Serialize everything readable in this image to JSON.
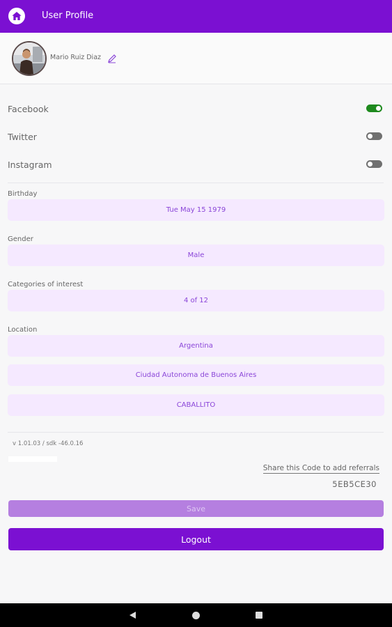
{
  "header": {
    "title": "User Profile",
    "home_icon": "home-icon",
    "bar_color": "#7b10d2"
  },
  "profile": {
    "name": "Mario Ruiz Diaz",
    "edit_icon": "pencil-icon"
  },
  "social": [
    {
      "label": "Facebook",
      "enabled": true
    },
    {
      "label": "Twitter",
      "enabled": false
    },
    {
      "label": "Instagram",
      "enabled": false
    }
  ],
  "fields": {
    "birthday": {
      "label": "Birthday",
      "value": "Tue May 15 1979"
    },
    "gender": {
      "label": "Gender",
      "value": "Male"
    },
    "categories": {
      "label": "Categories of interest",
      "value": "4 of 12"
    },
    "location": {
      "label": "Location",
      "country": "Argentina",
      "province": "Ciudad Autonoma de Buenos Aires",
      "neighborhood": "CABALLITO"
    }
  },
  "footer": {
    "version": "v 1.01.03 / sdk -46.0.16",
    "share_text": "Share this Code to add referrals",
    "referral_code": "5EB5CE30"
  },
  "actions": {
    "save": "Save",
    "logout": "Logout"
  },
  "colors": {
    "accent": "#7b10d2",
    "field_bg": "#f5e9ff",
    "toggle_on": "#1e8a1e",
    "toggle_off": "#707070"
  },
  "system_nav": {
    "back_icon": "back-triangle-icon",
    "home_icon": "home-circle-icon",
    "recents_icon": "recents-square-icon"
  }
}
